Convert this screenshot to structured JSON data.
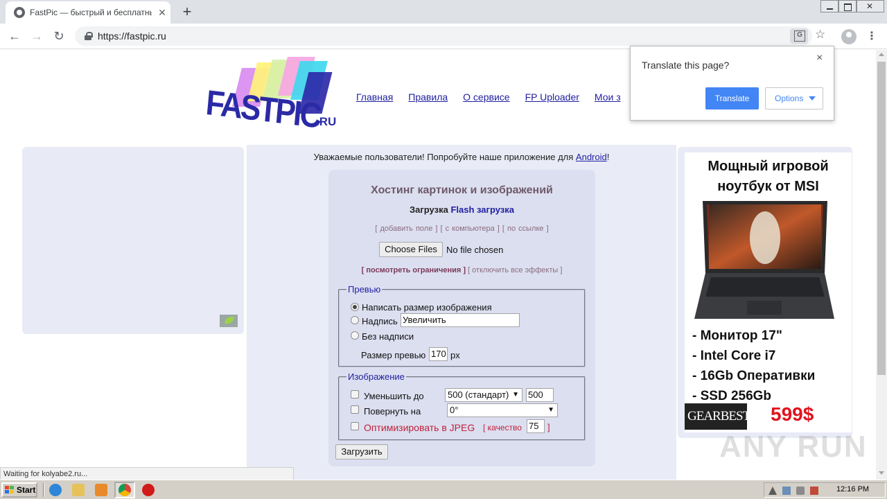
{
  "browser": {
    "tab_title": "FastPic — быстрый и бесплатный х",
    "url": "https://fastpic.ru",
    "tab_close": "✕",
    "new_tab": "+",
    "nav_back": "←",
    "nav_forward": "→",
    "nav_reload": "↻",
    "star": "☆",
    "menu": "⋮"
  },
  "translate_popup": {
    "title": "Translate this page?",
    "close": "×",
    "translate_label": "Translate",
    "options_label": "Options",
    "accent_color": "#4285f4"
  },
  "site": {
    "logo_text": "FASTPIC",
    "logo_suffix": ".RU",
    "nav": [
      "Главная",
      "Правила",
      "О сервисе",
      "FP Uploader",
      "Мои з"
    ],
    "announcement_prefix": "Уважаемые пользователи! Попробуйте наше приложение для ",
    "announcement_link": "Android",
    "announcement_suffix": "!"
  },
  "upload": {
    "title": "Хостинг картинок и изображений",
    "mode_active": "Загрузка",
    "mode_flash": "Flash загрузка",
    "source_links": "[ добавить поле ] [ с компьютера ] [ по ссылке ]",
    "choose_files_label": "Choose Files",
    "no_file_text": "No file chosen",
    "limits_link": "[ посмотреть ограничения ]",
    "effects_link": "[ отключить все эффекты ]",
    "submit_label": "Загрузить"
  },
  "preview": {
    "legend": "Превью",
    "option_size": "Написать размер изображения",
    "option_caption": "Надпись",
    "caption_value": "Увеличить",
    "option_none": "Без надписи",
    "size_label": "Размер превью",
    "size_value": "170",
    "size_unit": "px"
  },
  "image": {
    "legend": "Изображение",
    "reduce_label": "Уменьшить до",
    "reduce_select": "500 (стандарт)",
    "reduce_value": "500",
    "rotate_label": "Повернуть на",
    "rotate_select": "0°",
    "optimize_label": "Оптимизировать в JPEG",
    "quality_prefix": "[ качество",
    "quality_value": "75",
    "quality_suffix": "]"
  },
  "ad": {
    "title": "Мощный игровой ноутбук от MSI",
    "specs": [
      "- Монитор 17\"",
      "- Intel Core i7",
      "- 16Gb Оперативки",
      "- SSD 256Gb"
    ],
    "brand": "GEARBEST",
    "price": "599$"
  },
  "status_text": "Waiting for kolyabe2.ru...",
  "watermark": "ANY RUN",
  "taskbar": {
    "start_label": "Start",
    "clock": "12:16 PM"
  }
}
